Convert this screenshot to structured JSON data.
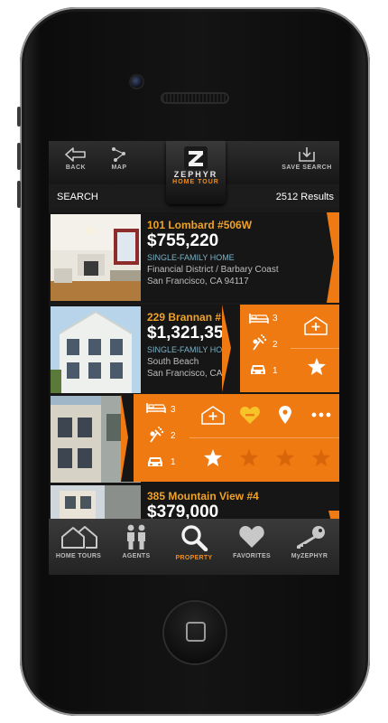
{
  "topbar": {
    "back_label": "BACK",
    "map_label": "MAP",
    "save_search_label": "SAVE SEARCH",
    "logo_name": "ZEPHYR",
    "logo_sub": "HOME TOUR"
  },
  "search": {
    "label": "SEARCH",
    "results": "2512 Results"
  },
  "listings": [
    {
      "address": "101 Lombard #506W",
      "price": "$755,220",
      "type": "SINGLE-FAMILY HOME",
      "area": "Financial District / Barbary Coast",
      "city": "San Francisco, CA  94117"
    },
    {
      "address": "229 Brannan #",
      "price": "$1,321,35",
      "type": "SINGLE-FAMILY HO",
      "area": "South Beach",
      "city": "San Francisco, CA"
    },
    {
      "address": "385 Mountain View #4",
      "price": "$379,000"
    }
  ],
  "panel_small": {
    "beds": "3",
    "baths": "2",
    "parking": "1"
  },
  "panel_large": {
    "beds": "3",
    "baths": "2",
    "parking": "1"
  },
  "tabbar": {
    "items": [
      {
        "label": "HOME TOURS",
        "icon": "houses-icon"
      },
      {
        "label": "AGENTS",
        "icon": "people-icon"
      },
      {
        "label": "PROPERTY",
        "icon": "magnifier-icon"
      },
      {
        "label": "FAVORITES",
        "icon": "heart-icon"
      },
      {
        "label": "MyZEPHYR",
        "icon": "key-icon"
      }
    ],
    "active_index": 2
  },
  "colors": {
    "accent": "#ef7a12",
    "address": "#f0a228",
    "type": "#7ab2c6"
  }
}
